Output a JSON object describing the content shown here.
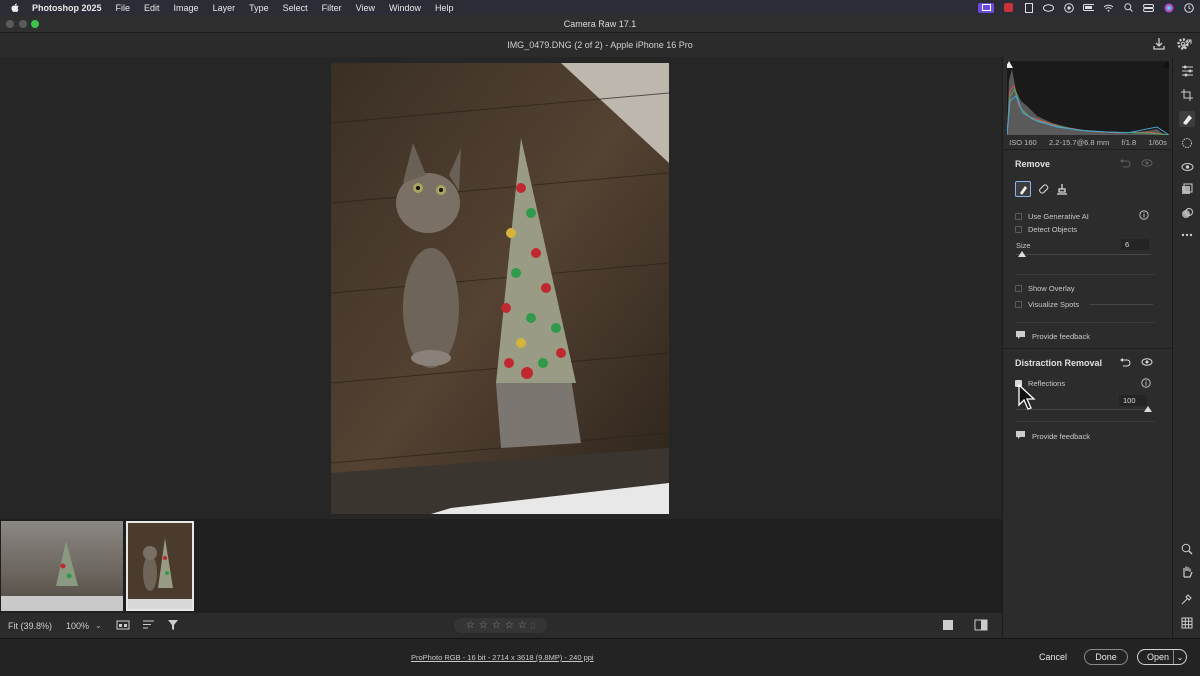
{
  "menubar": {
    "app_name": "Photoshop 2025",
    "items": [
      "File",
      "Edit",
      "Image",
      "Layer",
      "Type",
      "Select",
      "Filter",
      "View",
      "Window",
      "Help"
    ]
  },
  "window": {
    "title": "Camera Raw 17.1"
  },
  "header": {
    "file_info": "IMG_0479.DNG (2 of 2)  -  Apple iPhone 16 Pro"
  },
  "exif": {
    "iso": "ISO 160",
    "lens": "2.2-15.7@6.8 mm",
    "aperture": "f/1.8",
    "shutter": "1/60s"
  },
  "remove": {
    "title": "Remove",
    "use_generative_ai": "Use Generative AI",
    "detect_objects": "Detect Objects",
    "size_label": "Size",
    "size_value": "6",
    "show_overlay": "Show Overlay",
    "visualize_spots": "Visualize Spots",
    "feedback": "Provide feedback"
  },
  "distraction": {
    "title": "Distraction Removal",
    "reflections": "Reflections",
    "amount_value": "100",
    "feedback": "Provide feedback"
  },
  "bottom_toolbar": {
    "fit": "Fit (39.8%)",
    "zoom": "100%"
  },
  "footer": {
    "info": "ProPhoto RGB - 16 bit - 2714 x 3618 (9.8MP) - 240 ppi",
    "cancel": "Cancel",
    "done": "Done",
    "open": "Open"
  }
}
